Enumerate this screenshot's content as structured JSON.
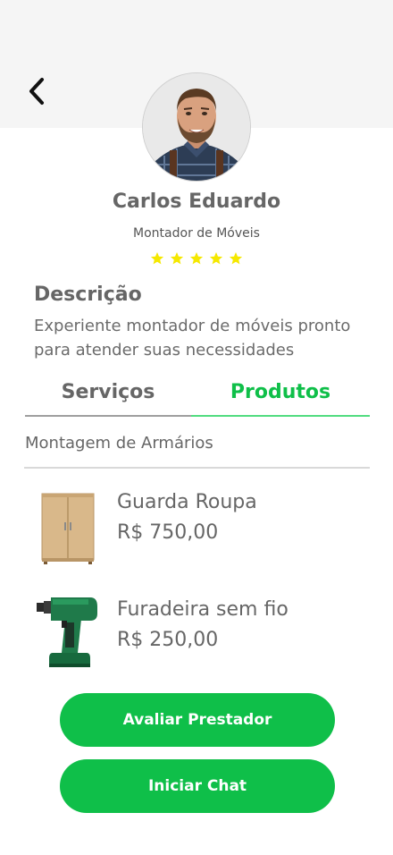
{
  "header": {
    "back_icon": "chevron-left-icon"
  },
  "provider": {
    "name": "Carlos Eduardo",
    "role": "Montador de Móveis",
    "rating": 5,
    "rating_max": 5,
    "star_color": "#f5e800"
  },
  "description": {
    "title": "Descrição",
    "text": "Experiente montador de móveis pronto para atender suas necessidades"
  },
  "tabs": [
    {
      "label": "Serviços",
      "active": false
    },
    {
      "label": "Produtos",
      "active": true
    }
  ],
  "category": "Montagem de Armários",
  "products": [
    {
      "name": "Guarda Roupa",
      "price": "R$ 750,00",
      "image": "wardrobe-image"
    },
    {
      "name": "Furadeira sem fio",
      "price": "R$ 250,00",
      "image": "cordless-drill-image"
    }
  ],
  "actions": {
    "rate_label": "Avaliar Prestador",
    "chat_label": "Iniciar Chat"
  },
  "colors": {
    "accent": "#0fbf49",
    "text": "#666666",
    "header_bg": "#f5f5f5"
  }
}
